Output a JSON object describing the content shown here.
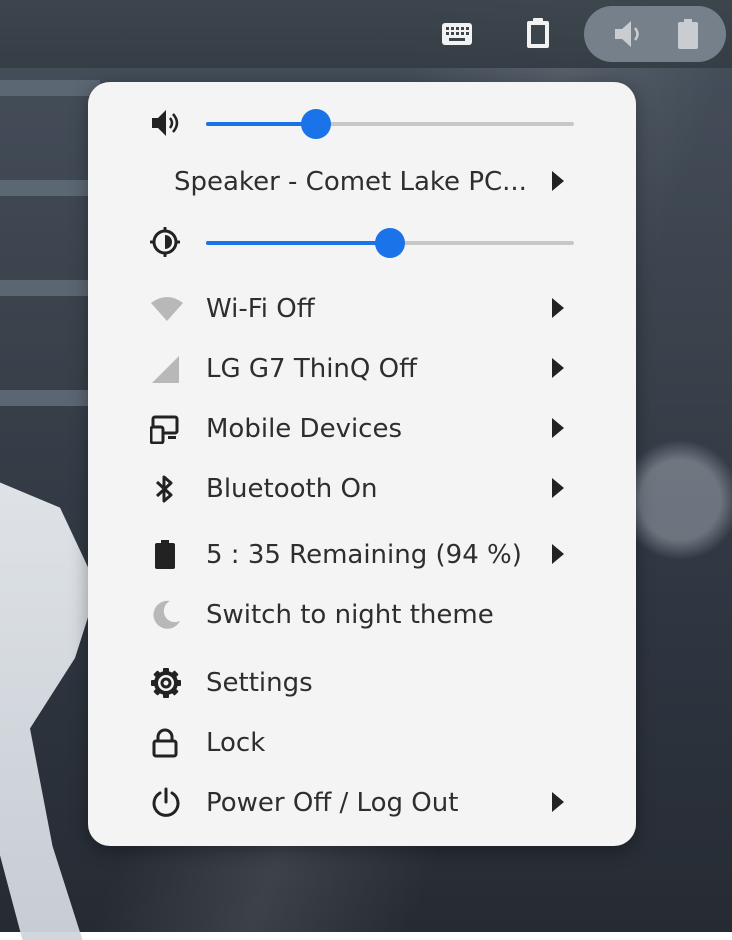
{
  "volume": {
    "level": 0.3
  },
  "output_device": {
    "label": "Speaker - Comet Lake PC..."
  },
  "brightness": {
    "level": 0.5
  },
  "items": [
    {
      "label": "Wi-Fi Off",
      "icon": "wifi-off-icon"
    },
    {
      "label": "LG G7 ThinQ Off",
      "icon": "mobile-signal-off-icon"
    },
    {
      "label": "Mobile Devices",
      "icon": "mobile-devices-icon"
    },
    {
      "label": "Bluetooth On",
      "icon": "bluetooth-icon"
    },
    {
      "label": "5 : 35 Remaining (94 %)",
      "icon": "battery-icon"
    },
    {
      "label": "Switch to night theme",
      "icon": "moon-icon"
    },
    {
      "label": "Settings",
      "icon": "gear-icon"
    },
    {
      "label": "Lock",
      "icon": "lock-icon"
    },
    {
      "label": "Power Off / Log Out",
      "icon": "power-icon"
    }
  ],
  "colors": {
    "accent": "#1a73e8",
    "menu_bg": "#f4f4f4",
    "text": "#2e2e2e"
  }
}
